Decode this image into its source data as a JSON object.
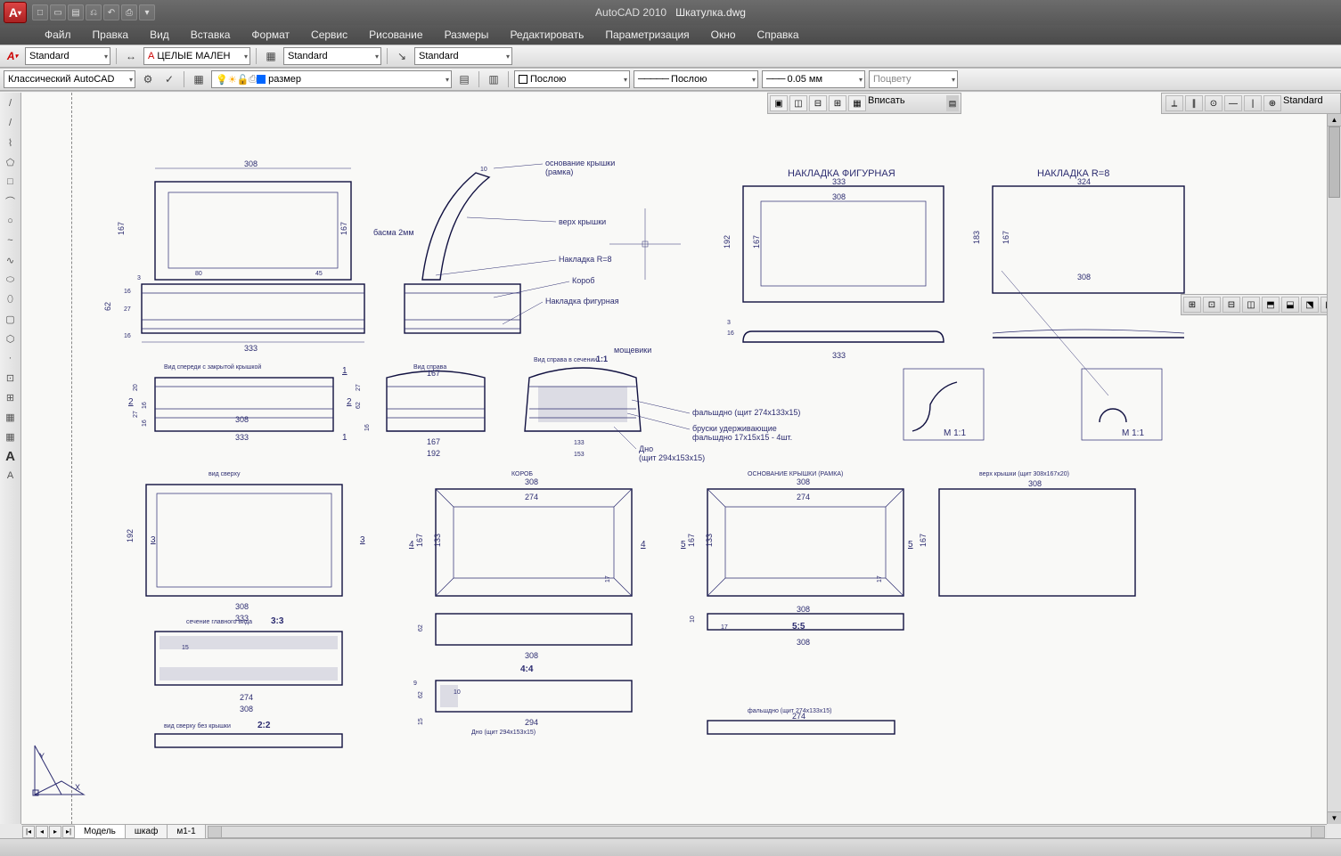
{
  "title": {
    "app": "AutoCAD 2010",
    "file": "Шкатулка.dwg"
  },
  "qat": [
    "□",
    "▭",
    "▤",
    "⎌",
    "↶",
    "↷",
    "⎙",
    "▾"
  ],
  "menus": [
    "Файл",
    "Правка",
    "Вид",
    "Вставка",
    "Формат",
    "Сервис",
    "Рисование",
    "Размеры",
    "Редактировать",
    "Параметризация",
    "Окно",
    "Справка"
  ],
  "row1": {
    "style": "Standard",
    "dim": "ЦЕЛЫЕ МАЛЕН",
    "table": "Standard",
    "mleader": "Standard"
  },
  "row2": {
    "workspace": "Классический AutoCAD",
    "layer": "размер",
    "color": "Послою",
    "ltype": "Послою",
    "lweight": "0.05 мм",
    "plotstyle": "Поцвету"
  },
  "row3_btns": [
    "□",
    "▭",
    "▤",
    "⎙",
    "🔍",
    "▦",
    "▥",
    "⊞",
    "✂",
    "⧉",
    "⎘",
    "⎗",
    "🖉",
    "⌫",
    "↶",
    "▾",
    "↷",
    "▾",
    "🖐",
    "🔍",
    "⊕",
    "⊡",
    "▦",
    "▥",
    "▦",
    "▧",
    "▦",
    "▦",
    "▦",
    "⌧",
    "?"
  ],
  "leftpal": [
    "/",
    "/",
    "□",
    "○",
    "⌒",
    "~",
    "⊙",
    "⬭",
    "⬯",
    "▢",
    "⬡",
    "·",
    "⊡",
    "⊞",
    "▦",
    "A",
    "A"
  ],
  "vpctrl": {
    "fit": "Вписать"
  },
  "rstrip1": {
    "label": "Standard"
  },
  "tabs": {
    "t1": "Модель",
    "t2": "шкаф",
    "t3": "м1-1"
  },
  "drawing": {
    "title_nakladka_fig": "НАКЛАДКА ФИГУРНАЯ",
    "title_nakladka_r8": "НАКЛАДКА R=8",
    "lbl_osn_kryshki": "основание крышки",
    "lbl_ramka": "(рамка)",
    "lbl_verh_kryshki": "верх крышки",
    "lbl_basma": "басма 2мм",
    "lbl_nakladka_r8": "Накладка R=8",
    "lbl_korob": "Короб",
    "lbl_nakladka_fig": "Накладка фигурная",
    "lbl_moschviki": "мощевики",
    "lbl_falshdno": "фальшдно (щит 274х133х15)",
    "lbl_bruski": "бруски удерживающие",
    "lbl_bruski2": "фальшдно 17х15х15 - 4шт.",
    "lbl_dno": "Дно",
    "lbl_dno2": "(щит 294х153х15)",
    "lbl_vid_speredi": "Вид спереди с закрытой крышкой",
    "lbl_vid_sprava": "Вид справа",
    "lbl_vid_sprava_sech": "Вид справа в сечении",
    "lbl_11": "1:1",
    "lbl_m11": "M 1:1",
    "lbl_vid_sverhu": "вид сверху",
    "lbl_korob2": "КОРОБ",
    "lbl_osn_kryshki2": "ОСНОВАНИЕ КРЫШКИ (РАМКА)",
    "lbl_verh_kryshki2": "верх крышки (щит 308х167х20)",
    "lbl_sech_gl": "сечение главного вида",
    "lbl_33": "3:3",
    "lbl_44": "4:4",
    "lbl_55": "5:5",
    "lbl_22": "2:2",
    "lbl_vid_sverhu_bez": "вид сверху без крышки",
    "lbl_falshdno2": "фальшдно (щит 274х133х15)",
    "lbl_dno3": "Дно (щит 294х153х15)",
    "lbl_1": "1",
    "lbl_2": "2",
    "lbl_3": "3",
    "lbl_4": "4",
    "lbl_5": "5",
    "d308": "308",
    "d333": "333",
    "d324": "324",
    "d10": "10",
    "d167": "167",
    "d192": "192",
    "d183": "183",
    "d62": "62",
    "d80": "80",
    "d45": "45",
    "d16": "16",
    "d27": "27",
    "d3": "3",
    "d20": "20",
    "d274": "274",
    "d294": "294",
    "d133": "133",
    "d153": "153",
    "d17": "17",
    "d15": "15",
    "d9": "9"
  }
}
